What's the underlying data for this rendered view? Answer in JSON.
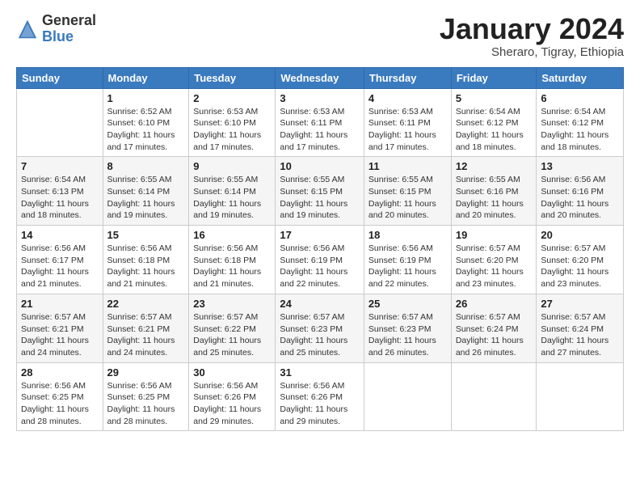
{
  "logo": {
    "general": "General",
    "blue": "Blue"
  },
  "title": "January 2024",
  "subtitle": "Sheraro, Tigray, Ethiopia",
  "weekdays": [
    "Sunday",
    "Monday",
    "Tuesday",
    "Wednesday",
    "Thursday",
    "Friday",
    "Saturday"
  ],
  "weeks": [
    [
      {
        "day": null
      },
      {
        "day": "1",
        "sunrise": "6:52 AM",
        "sunset": "6:10 PM",
        "daylight": "11 hours and 17 minutes."
      },
      {
        "day": "2",
        "sunrise": "6:53 AM",
        "sunset": "6:10 PM",
        "daylight": "11 hours and 17 minutes."
      },
      {
        "day": "3",
        "sunrise": "6:53 AM",
        "sunset": "6:11 PM",
        "daylight": "11 hours and 17 minutes."
      },
      {
        "day": "4",
        "sunrise": "6:53 AM",
        "sunset": "6:11 PM",
        "daylight": "11 hours and 17 minutes."
      },
      {
        "day": "5",
        "sunrise": "6:54 AM",
        "sunset": "6:12 PM",
        "daylight": "11 hours and 18 minutes."
      },
      {
        "day": "6",
        "sunrise": "6:54 AM",
        "sunset": "6:12 PM",
        "daylight": "11 hours and 18 minutes."
      }
    ],
    [
      {
        "day": "7",
        "sunrise": "6:54 AM",
        "sunset": "6:13 PM",
        "daylight": "11 hours and 18 minutes."
      },
      {
        "day": "8",
        "sunrise": "6:55 AM",
        "sunset": "6:14 PM",
        "daylight": "11 hours and 19 minutes."
      },
      {
        "day": "9",
        "sunrise": "6:55 AM",
        "sunset": "6:14 PM",
        "daylight": "11 hours and 19 minutes."
      },
      {
        "day": "10",
        "sunrise": "6:55 AM",
        "sunset": "6:15 PM",
        "daylight": "11 hours and 19 minutes."
      },
      {
        "day": "11",
        "sunrise": "6:55 AM",
        "sunset": "6:15 PM",
        "daylight": "11 hours and 20 minutes."
      },
      {
        "day": "12",
        "sunrise": "6:55 AM",
        "sunset": "6:16 PM",
        "daylight": "11 hours and 20 minutes."
      },
      {
        "day": "13",
        "sunrise": "6:56 AM",
        "sunset": "6:16 PM",
        "daylight": "11 hours and 20 minutes."
      }
    ],
    [
      {
        "day": "14",
        "sunrise": "6:56 AM",
        "sunset": "6:17 PM",
        "daylight": "11 hours and 21 minutes."
      },
      {
        "day": "15",
        "sunrise": "6:56 AM",
        "sunset": "6:18 PM",
        "daylight": "11 hours and 21 minutes."
      },
      {
        "day": "16",
        "sunrise": "6:56 AM",
        "sunset": "6:18 PM",
        "daylight": "11 hours and 21 minutes."
      },
      {
        "day": "17",
        "sunrise": "6:56 AM",
        "sunset": "6:19 PM",
        "daylight": "11 hours and 22 minutes."
      },
      {
        "day": "18",
        "sunrise": "6:56 AM",
        "sunset": "6:19 PM",
        "daylight": "11 hours and 22 minutes."
      },
      {
        "day": "19",
        "sunrise": "6:57 AM",
        "sunset": "6:20 PM",
        "daylight": "11 hours and 23 minutes."
      },
      {
        "day": "20",
        "sunrise": "6:57 AM",
        "sunset": "6:20 PM",
        "daylight": "11 hours and 23 minutes."
      }
    ],
    [
      {
        "day": "21",
        "sunrise": "6:57 AM",
        "sunset": "6:21 PM",
        "daylight": "11 hours and 24 minutes."
      },
      {
        "day": "22",
        "sunrise": "6:57 AM",
        "sunset": "6:21 PM",
        "daylight": "11 hours and 24 minutes."
      },
      {
        "day": "23",
        "sunrise": "6:57 AM",
        "sunset": "6:22 PM",
        "daylight": "11 hours and 25 minutes."
      },
      {
        "day": "24",
        "sunrise": "6:57 AM",
        "sunset": "6:23 PM",
        "daylight": "11 hours and 25 minutes."
      },
      {
        "day": "25",
        "sunrise": "6:57 AM",
        "sunset": "6:23 PM",
        "daylight": "11 hours and 26 minutes."
      },
      {
        "day": "26",
        "sunrise": "6:57 AM",
        "sunset": "6:24 PM",
        "daylight": "11 hours and 26 minutes."
      },
      {
        "day": "27",
        "sunrise": "6:57 AM",
        "sunset": "6:24 PM",
        "daylight": "11 hours and 27 minutes."
      }
    ],
    [
      {
        "day": "28",
        "sunrise": "6:56 AM",
        "sunset": "6:25 PM",
        "daylight": "11 hours and 28 minutes."
      },
      {
        "day": "29",
        "sunrise": "6:56 AM",
        "sunset": "6:25 PM",
        "daylight": "11 hours and 28 minutes."
      },
      {
        "day": "30",
        "sunrise": "6:56 AM",
        "sunset": "6:26 PM",
        "daylight": "11 hours and 29 minutes."
      },
      {
        "day": "31",
        "sunrise": "6:56 AM",
        "sunset": "6:26 PM",
        "daylight": "11 hours and 29 minutes."
      },
      {
        "day": null
      },
      {
        "day": null
      },
      {
        "day": null
      }
    ]
  ],
  "labels": {
    "sunrise": "Sunrise:",
    "sunset": "Sunset:",
    "daylight": "Daylight:"
  }
}
